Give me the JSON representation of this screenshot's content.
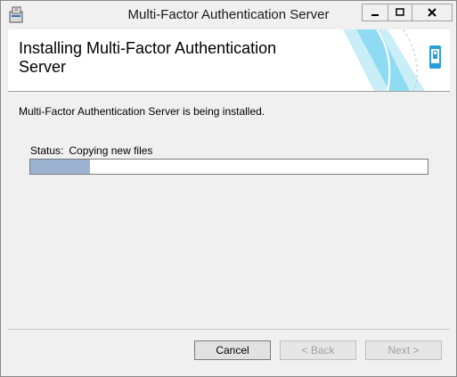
{
  "window": {
    "title": "Multi-Factor Authentication Server",
    "app_icon": "installer-icon"
  },
  "banner": {
    "title": "Installing Multi-Factor Authentication Server",
    "art_icon": "phone-lock-icon",
    "colors": {
      "accent": "#5cc8e8",
      "phone": "#2aa0d8"
    }
  },
  "body": {
    "message": "Multi-Factor Authentication Server is being installed.",
    "status_label": "Status:",
    "status_value": "Copying new files",
    "progress_fraction": 0.15,
    "progress_color": "#9bb3d0"
  },
  "buttons": {
    "cancel": "Cancel",
    "back": "< Back",
    "next": "Next >"
  }
}
